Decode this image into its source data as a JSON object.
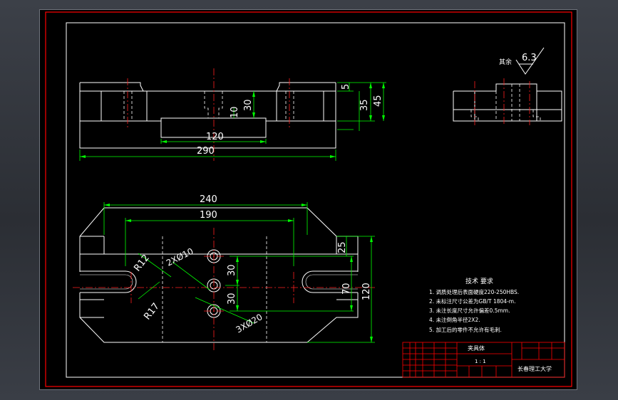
{
  "dimensions": {
    "d_5": "5",
    "d_30": "30",
    "d_10": "10",
    "d_35": "35",
    "d_45": "45",
    "d_120_front": "120",
    "d_290": "290",
    "d_240": "240",
    "d_190": "190",
    "d_25": "25",
    "d_r12": "R12",
    "d_r17": "R17",
    "d_holes10": "2XØ10",
    "d_holes20": "3XØ20",
    "d_30a": "30",
    "d_30b": "30",
    "d_70": "70",
    "d_120_plan": "120"
  },
  "roughness": {
    "label": "其余",
    "value": "6.3"
  },
  "tech_requirements": {
    "title": "技术 要求",
    "items": [
      "1. 调质处理后表面硬度220-250HBS.",
      "2. 未标注尺寸公差为GB/T 1804-m.",
      "3. 未注长度尺寸允许偏差0.5mm.",
      "4. 未注倒角半径2X2.",
      "5. 加工后的零件不允许有毛刺."
    ]
  },
  "title_block": {
    "part_name": "夹具体",
    "scale": "1 : 1",
    "school": "长春理工大学"
  },
  "colors": {
    "app_bg": "#2b2e34",
    "canvas": "#000000",
    "frame": "#ff0000",
    "outline": "#ffffff",
    "hidden": "#ffffff",
    "center": "#ff2020",
    "dimension": "#00ff00",
    "text": "#ffffff"
  }
}
